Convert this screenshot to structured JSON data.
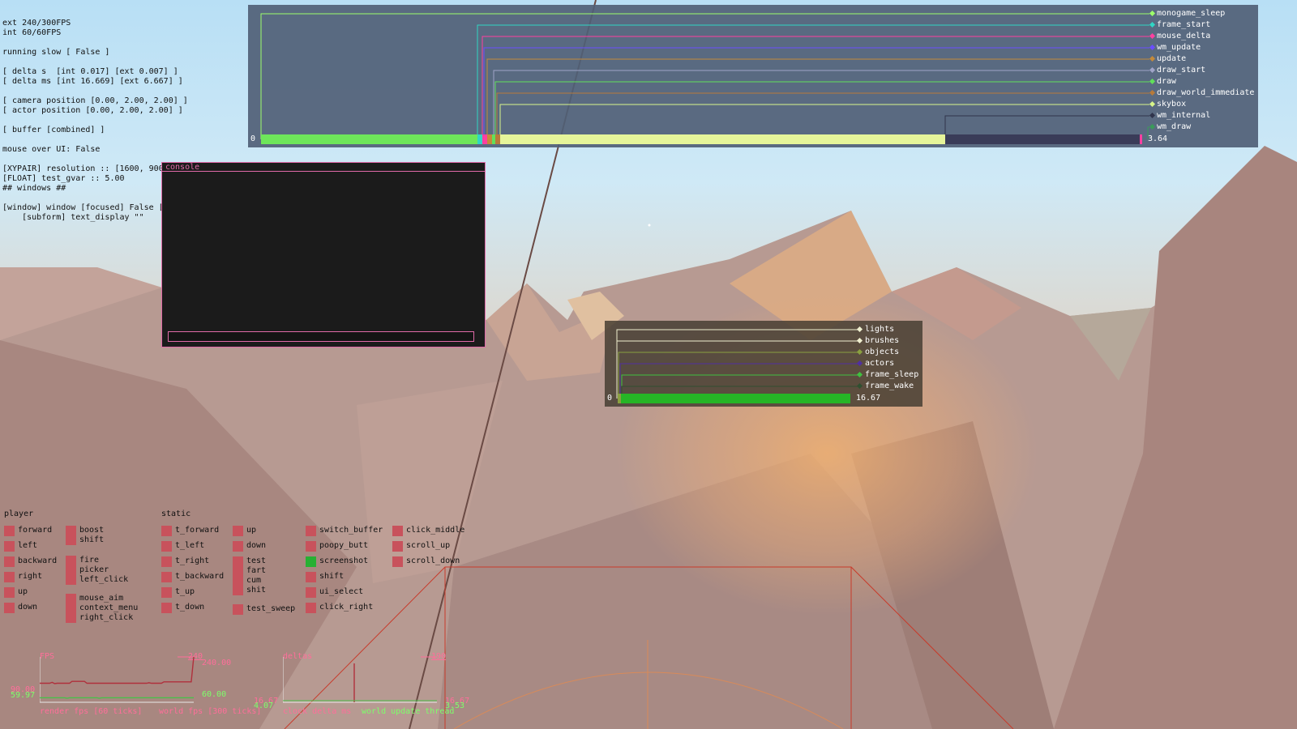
{
  "debug": {
    "lines": [
      "ext 240/300FPS",
      "int 60/60FPS",
      "",
      "running slow [ False ]",
      "",
      "[ delta s  [int 0.017] [ext 0.007] ]",
      "[ delta ms [int 16.669] [ext 6.667] ]",
      "",
      "[ camera position [0.00, 2.00, 2.00] ]",
      "[ actor position [0.00, 2.00, 2.00] ]",
      "",
      "[ buffer [combined] ]",
      "",
      "mouse over UI: False",
      "",
      "[XYPAIR] resolution :: [1600, 900]",
      "[FLOAT] test_gvar :: 5.00",
      "## windows ##",
      "",
      "[window] window [focused] False [",
      "    [subform] text_display \"\""
    ]
  },
  "profiler_top": {
    "zero": "0",
    "value": "3.64",
    "labels": [
      {
        "text": "monogame_sleep",
        "color": "#9dff6a"
      },
      {
        "text": "frame_start",
        "color": "#30d6c4"
      },
      {
        "text": "mouse_delta",
        "color": "#ff3fa0"
      },
      {
        "text": "wm_update",
        "color": "#6a4dff"
      },
      {
        "text": "update",
        "color": "#c48a3a"
      },
      {
        "text": "draw_start",
        "color": "#a0a4c8"
      },
      {
        "text": "draw",
        "color": "#61e05a"
      },
      {
        "text": "draw_world_immediate",
        "color": "#b87a3a"
      },
      {
        "text": "skybox",
        "color": "#d8f58a"
      },
      {
        "text": "wm_internal",
        "color": "#30344c"
      },
      {
        "text": "wm_draw",
        "color": "#3a9a5a"
      }
    ]
  },
  "profiler_mid": {
    "zero": "0",
    "value": "16.67",
    "labels": [
      {
        "text": "lights",
        "color": "#f0f0d0"
      },
      {
        "text": "brushes",
        "color": "#f0f0d0"
      },
      {
        "text": "objects",
        "color": "#8aa040"
      },
      {
        "text": "actors",
        "color": "#5030a0"
      },
      {
        "text": "frame_sleep",
        "color": "#40c040"
      },
      {
        "text": "frame_wake",
        "color": "#305030"
      }
    ]
  },
  "console": {
    "title": "console",
    "input_value": ""
  },
  "inputs": {
    "player_title": "player",
    "static_title": "static",
    "buttons": [
      {
        "id": "forward",
        "label": "forward",
        "on": false
      },
      {
        "id": "left",
        "label": "left",
        "on": false
      },
      {
        "id": "backward",
        "label": "backward",
        "on": false
      },
      {
        "id": "right",
        "label": "right",
        "on": false
      },
      {
        "id": "up",
        "label": "up",
        "on": false
      },
      {
        "id": "down",
        "label": "down",
        "on": false
      },
      {
        "id": "boost",
        "label": "boost\nshift",
        "on": false
      },
      {
        "id": "fire",
        "label": "fire\npicker\nleft_click",
        "on": false
      },
      {
        "id": "mouse_aim",
        "label": "mouse_aim\ncontext_menu\nright_click",
        "on": false
      },
      {
        "id": "t_forward",
        "label": "t_forward",
        "on": false
      },
      {
        "id": "t_left",
        "label": "t_left",
        "on": false
      },
      {
        "id": "t_right",
        "label": "t_right",
        "on": false
      },
      {
        "id": "t_backward",
        "label": "t_backward",
        "on": false
      },
      {
        "id": "t_up",
        "label": "t_up",
        "on": false
      },
      {
        "id": "t_down",
        "label": "t_down",
        "on": false
      },
      {
        "id": "s_up",
        "label": "up",
        "on": false
      },
      {
        "id": "s_down",
        "label": "down",
        "on": false
      },
      {
        "id": "test",
        "label": "test\nfart\ncum\nshit",
        "on": false
      },
      {
        "id": "test_sweep",
        "label": "test_sweep",
        "on": false
      },
      {
        "id": "switch_buffer",
        "label": "switch_buffer",
        "on": false
      },
      {
        "id": "poopy_butt",
        "label": "poopy_butt",
        "on": false
      },
      {
        "id": "screenshot",
        "label": "screenshot",
        "on": true
      },
      {
        "id": "shift",
        "label": "shift",
        "on": false
      },
      {
        "id": "ui_select",
        "label": "ui_select",
        "on": false
      },
      {
        "id": "click_right",
        "label": "click_right",
        "on": false
      },
      {
        "id": "click_middle",
        "label": "click_middle",
        "on": false
      },
      {
        "id": "scroll_up",
        "label": "scroll_up",
        "on": false
      },
      {
        "id": "scroll_down",
        "label": "scroll_down",
        "on": false
      }
    ]
  },
  "fps_graph": {
    "title": "FPS",
    "max_label": "240",
    "ext_value": "240.00",
    "int_value": "60.00",
    "left_hi": "90.00",
    "left_lo": "59.97",
    "caption_render": "render fps [60 ticks]",
    "caption_world": "world fps [300 ticks]",
    "ext_series": [
      92,
      92,
      92,
      92,
      92,
      94,
      91,
      92,
      92,
      92,
      92,
      92,
      92,
      96,
      96,
      96,
      96,
      96,
      96,
      92,
      92,
      92,
      92,
      92,
      92,
      92,
      92,
      92,
      92,
      92,
      92,
      92,
      92,
      92,
      92,
      92,
      92,
      92,
      92,
      92,
      92,
      92,
      92,
      92,
      93,
      92,
      92,
      92,
      92,
      92,
      95,
      95,
      95,
      95,
      95,
      95,
      95,
      95,
      95,
      95,
      95,
      95,
      240
    ],
    "int_series": [
      60,
      60,
      60,
      60,
      60,
      60,
      60,
      60,
      60,
      60,
      60,
      59,
      60,
      60,
      60,
      60,
      60,
      60,
      60,
      60,
      60,
      60,
      60,
      60,
      59,
      60,
      60,
      60,
      60,
      60,
      60,
      60,
      60,
      60,
      60,
      60,
      60,
      60,
      60,
      60,
      60,
      60,
      60,
      60,
      60,
      60,
      60,
      60,
      60,
      60,
      60,
      60,
      60,
      60,
      60,
      60,
      60,
      60,
      60,
      60,
      60,
      60,
      60
    ]
  },
  "delta_graph": {
    "title": "deltas",
    "max_label": "190",
    "ext_value": "16.67",
    "int_value": "3.53",
    "left_hi": "16.67",
    "left_lo": "4.07",
    "caption_clock": "clock delta ms",
    "caption_world": "world update thread",
    "spike_value": 190
  }
}
